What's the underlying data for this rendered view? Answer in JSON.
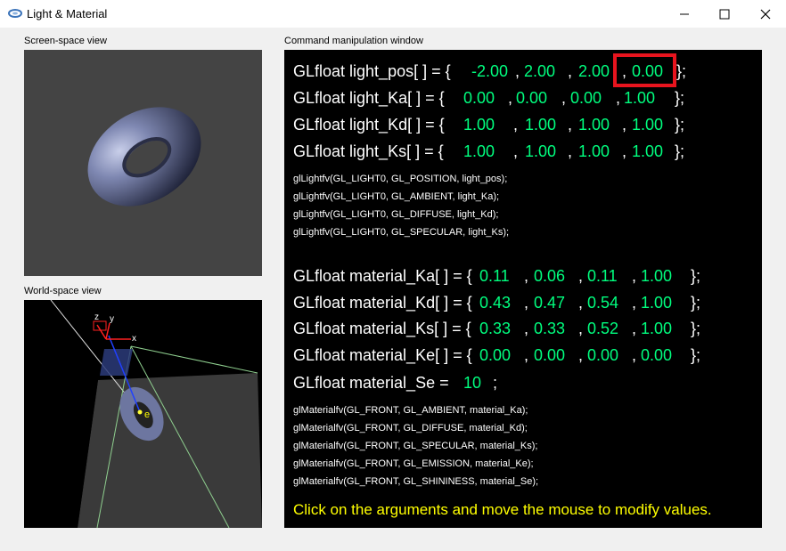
{
  "window": {
    "title": "Light & Material",
    "controls": {
      "minimize": "minimize",
      "maximize": "maximize",
      "close": "close"
    }
  },
  "screen_view": {
    "label": "Screen-space view"
  },
  "world_view": {
    "label": "World-space view",
    "axis_x": "x",
    "axis_y": "y",
    "axis_z": "z",
    "eye_label": "e"
  },
  "command_window": {
    "label": "Command manipulation window",
    "light_pos": {
      "decl": "GLfloat light_pos[ ] = {",
      "values": [
        "-2.00",
        "2.00",
        "2.00",
        "0.00"
      ],
      "end": "};"
    },
    "light_Ka": {
      "decl": "GLfloat light_Ka[ ] = {",
      "values": [
        "0.00",
        "0.00",
        "0.00",
        "1.00"
      ],
      "end": "};"
    },
    "light_Kd": {
      "decl": "GLfloat light_Kd[ ] = {",
      "values": [
        "1.00",
        "1.00",
        "1.00",
        "1.00"
      ],
      "end": "};"
    },
    "light_Ks": {
      "decl": "GLfloat light_Ks[ ] = {",
      "values": [
        "1.00",
        "1.00",
        "1.00",
        "1.00"
      ],
      "end": "};"
    },
    "light_calls": [
      "glLightfv(GL_LIGHT0, GL_POSITION, light_pos);",
      "glLightfv(GL_LIGHT0, GL_AMBIENT, light_Ka);",
      "glLightfv(GL_LIGHT0, GL_DIFFUSE, light_Kd);",
      "glLightfv(GL_LIGHT0, GL_SPECULAR, light_Ks);"
    ],
    "material_Ka": {
      "decl": "GLfloat material_Ka[ ] = {",
      "values": [
        "0.11",
        "0.06",
        "0.11",
        "1.00"
      ],
      "end": "};"
    },
    "material_Kd": {
      "decl": "GLfloat material_Kd[ ] = {",
      "values": [
        "0.43",
        "0.47",
        "0.54",
        "1.00"
      ],
      "end": "};"
    },
    "material_Ks": {
      "decl": "GLfloat material_Ks[ ] = {",
      "values": [
        "0.33",
        "0.33",
        "0.52",
        "1.00"
      ],
      "end": "};"
    },
    "material_Ke": {
      "decl": "GLfloat material_Ke[ ] = {",
      "values": [
        "0.00",
        "0.00",
        "0.00",
        "0.00"
      ],
      "end": "};"
    },
    "material_Se": {
      "decl": "GLfloat material_Se =",
      "value": "10",
      "end": ";"
    },
    "material_calls": [
      "glMaterialfv(GL_FRONT, GL_AMBIENT, material_Ka);",
      "glMaterialfv(GL_FRONT, GL_DIFFUSE, material_Kd);",
      "glMaterialfv(GL_FRONT, GL_SPECULAR, material_Ks);",
      "glMaterialfv(GL_FRONT, GL_EMISSION, material_Ke);",
      "glMaterialfv(GL_FRONT, GL_SHININESS, material_Se);"
    ],
    "hint": "Click on the arguments and move the mouse to modify values."
  },
  "colors": {
    "value": "#00ff7f",
    "text": "#ffffff",
    "hint": "#ffff00",
    "highlight": "#e8141e"
  }
}
